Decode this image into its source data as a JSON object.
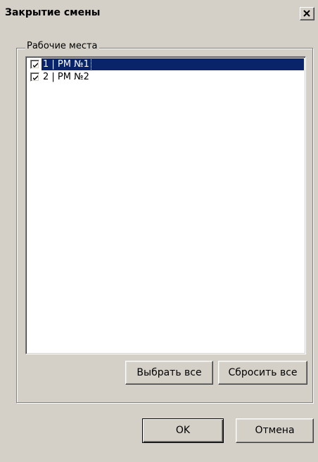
{
  "window": {
    "title": "Закрытие смены",
    "close_label": "X"
  },
  "group": {
    "label": "Рабочие места"
  },
  "list": {
    "items": [
      {
        "label": "1 | РМ №1",
        "checked": true,
        "selected": true
      },
      {
        "label": "2 | РМ №2",
        "checked": true,
        "selected": false
      }
    ]
  },
  "buttons": {
    "select_all": "Выбрать все",
    "reset_all": "Сбросить все",
    "ok": "OK",
    "cancel": "Отмена"
  },
  "colors": {
    "face": "#d4d0c8",
    "selection": "#0a246a",
    "list_background": "#ffffff"
  },
  "icons": {
    "close": "close-icon",
    "checkmark": "checkmark-icon"
  }
}
